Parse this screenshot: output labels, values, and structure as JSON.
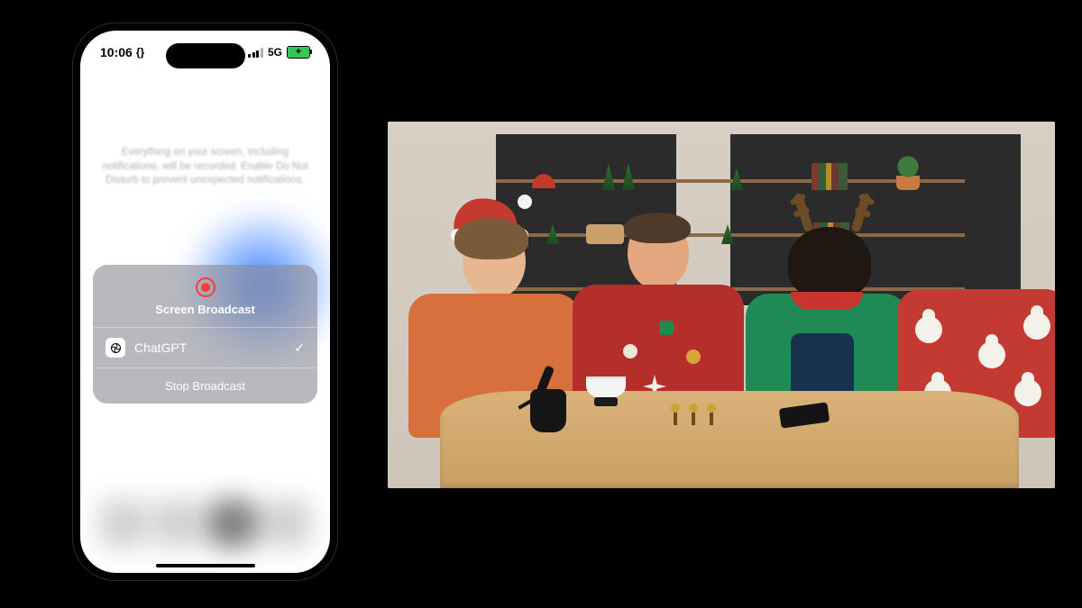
{
  "status_bar": {
    "time": "10:06",
    "dev_badge": "{}",
    "network_type": "5G"
  },
  "disclaimer": "Everything on your screen, including notifications, will be recorded. Enable Do Not Disturb to prevent unexpected notifications.",
  "broadcast_sheet": {
    "title": "Screen Broadcast",
    "app_row": {
      "label": "ChatGPT",
      "selected_glyph": "✓"
    },
    "stop_label": "Stop Broadcast"
  },
  "video_panel": {
    "description": "Four people in festive holiday sweaters seated at a wooden table with shelves and decorations behind them.",
    "people": [
      {
        "sweater_color": "#d8703e",
        "accessory": "santa-hat"
      },
      {
        "sweater_color": "#b42e2b",
        "accessory": "ornament-sweater"
      },
      {
        "sweater_color": "#1f8a55",
        "accessory": "reindeer-antlers"
      },
      {
        "sweater_color": "#c23a32",
        "accessory": "santa-pattern-sweater"
      }
    ],
    "table_items": [
      "black-kettle",
      "white-pour-over-cup",
      "hand-bells",
      "smartphone"
    ]
  }
}
